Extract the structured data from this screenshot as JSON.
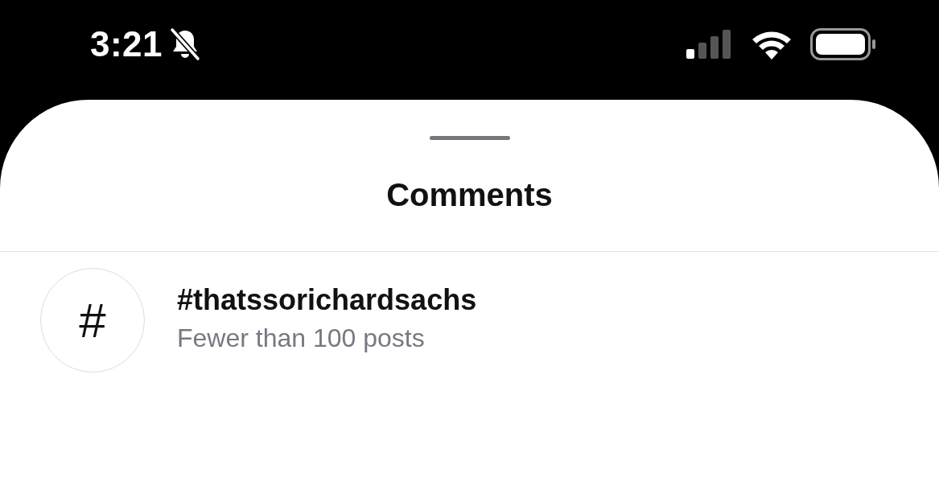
{
  "status_bar": {
    "time": "3:21"
  },
  "sheet": {
    "title": "Comments",
    "results": [
      {
        "icon_text": "#",
        "title": "#thatssorichardsachs",
        "subtitle": "Fewer than 100 posts"
      }
    ]
  }
}
